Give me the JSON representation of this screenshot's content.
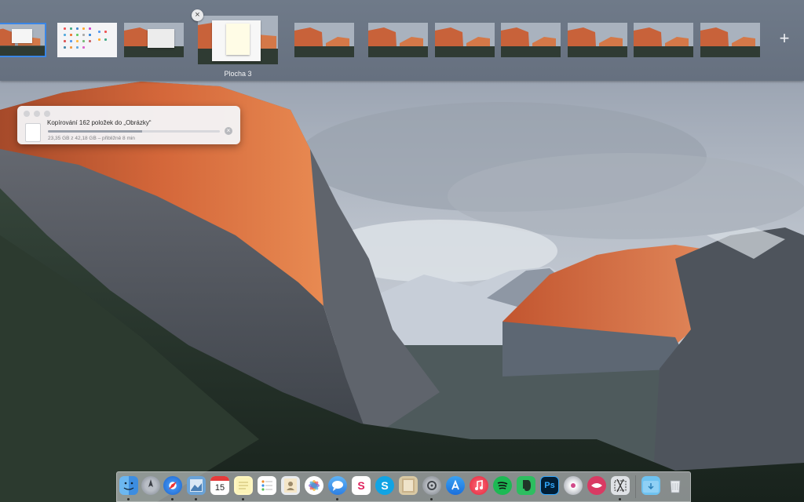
{
  "mission_control": {
    "current_space_label": "Plocha 3",
    "close_symbol": "×",
    "add_symbol": "+"
  },
  "copy_progress": {
    "title": "Kopírování 162 položek do „Obrázky“",
    "subtitle": "23,35 GB z 42,18 GB – přibližně 8 min",
    "progress_fraction": 0.55,
    "stop_symbol": "×"
  },
  "dock": {
    "calendar_day": "15",
    "photoshop_text": "Ps",
    "slack_text": "S"
  },
  "colors": {
    "accent": "#3a86e6",
    "spaces_bar": "#6b7586"
  }
}
